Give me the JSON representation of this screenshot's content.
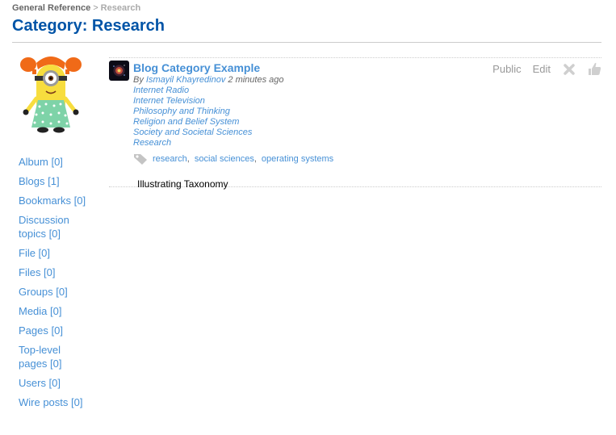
{
  "breadcrumb": {
    "parent": "General Reference",
    "separator": ">",
    "current": "Research"
  },
  "page": {
    "title": "Category: Research"
  },
  "sidebar": {
    "menu": [
      {
        "label": "Album [0]"
      },
      {
        "label": "Blogs [1]"
      },
      {
        "label": "Bookmarks [0]"
      },
      {
        "label": "Discussion topics [0]"
      },
      {
        "label": "File [0]"
      },
      {
        "label": "Files [0]"
      },
      {
        "label": "Groups [0]"
      },
      {
        "label": "Media [0]"
      },
      {
        "label": "Pages [0]"
      },
      {
        "label": "Top-level pages [0]"
      },
      {
        "label": "Users [0]"
      },
      {
        "label": "Wire posts [0]"
      }
    ]
  },
  "item": {
    "title": "Blog Category Example",
    "by": "By",
    "author": "Ismayil Khayredinov",
    "time": "2 minutes ago",
    "categories": [
      "Internet Radio",
      "Internet Television",
      "Philosophy and Thinking",
      "Religion and Belief System",
      "Society and Societal Sciences",
      "Research"
    ],
    "tags": [
      "research",
      "social sciences",
      "operating systems"
    ],
    "description": "Illustrating Taxonomy",
    "menu": {
      "access": "Public",
      "edit": "Edit"
    }
  },
  "icons": {
    "delete": "close-icon",
    "like": "thumbs-up-icon",
    "tag": "tag-icon"
  }
}
